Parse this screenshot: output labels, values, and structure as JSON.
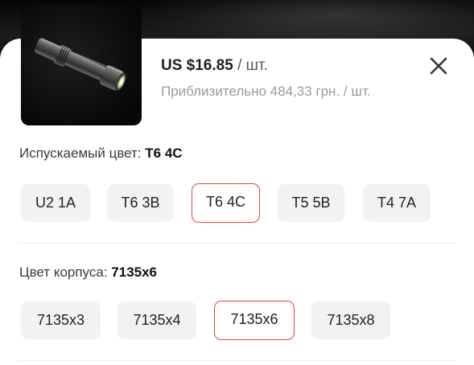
{
  "product": {
    "image_alt": "flashlight-image",
    "price": "US $16.85",
    "price_unit": " / шт.",
    "approx_price": "Приблизительно 484,33 грн. / шт."
  },
  "emission_color": {
    "label": "Испускаемый цвет: ",
    "selected": "T6 4C",
    "options": [
      "U2 1A",
      "T6 3B",
      "T6 4C",
      "T5 5B",
      "T4 7A"
    ]
  },
  "body_color": {
    "label": "Цвет корпуса: ",
    "selected": "7135x6",
    "options": [
      "7135x3",
      "7135x4",
      "7135x6",
      "7135x8"
    ]
  },
  "colors": {
    "accent": "#e0443f",
    "chip_bg": "#f2f2f2"
  },
  "icons": {
    "close": "close-icon"
  }
}
